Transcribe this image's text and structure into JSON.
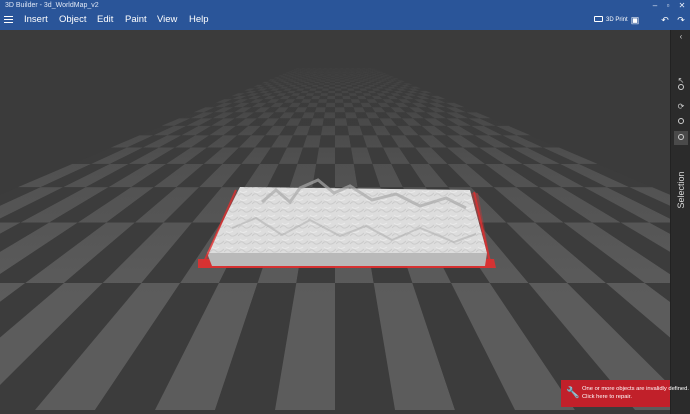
{
  "window": {
    "title": "3D Builder - 3d_WorldMap_v2",
    "minimize_icon": "minimize-icon",
    "maximize_icon": "maximize-icon",
    "close_icon": "close-icon"
  },
  "menu": {
    "hamburger_icon": "hamburger-menu-icon",
    "items": [
      "Insert",
      "Object",
      "Edit",
      "Paint",
      "View",
      "Help"
    ]
  },
  "toolbar": {
    "print_label": "3D Print",
    "print_icon": "3d-print-icon",
    "save_icon": "save-icon",
    "undo_icon": "undo-icon",
    "redo_icon": "redo-icon"
  },
  "sidebar": {
    "collapse_icon": "chevron-left-icon",
    "tools": [
      "select-tool-icon",
      "move-tool-icon",
      "rotate-tool-icon",
      "scale-tool-icon",
      "selection-tool-icon"
    ],
    "label": "Selection"
  },
  "viewport": {
    "object": "3d_WorldMap_v2",
    "object_color": "#e4e4e4",
    "invalid_highlight_color": "#e03030",
    "floor_light": "#5c5c5c",
    "floor_dark": "#3c3c3c"
  },
  "toast": {
    "icon": "wrench-icon",
    "line1": "One or more objects are invalidly defined.",
    "line2": "Click here to repair.",
    "color": "#c1202a"
  }
}
